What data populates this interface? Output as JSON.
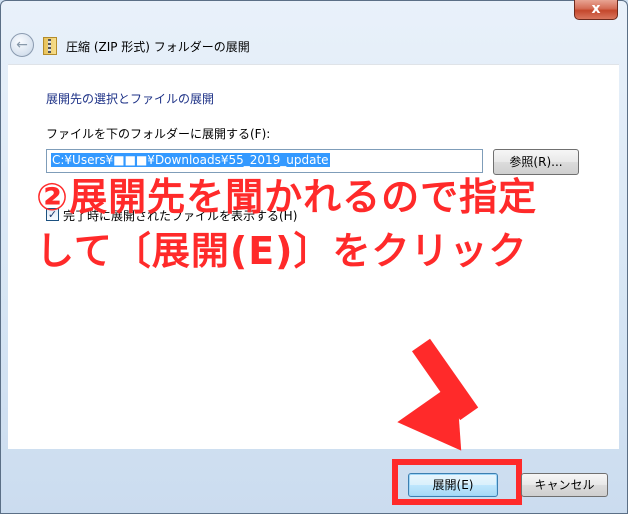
{
  "window": {
    "close_label": "x",
    "title": "圧縮 (ZIP 形式) フォルダーの展開"
  },
  "header": {
    "back_icon": "back-arrow-icon",
    "folder_icon": "zip-folder-icon"
  },
  "main": {
    "section_title": "展開先の選択とファイルの展開",
    "field_label": "ファイルを下のフォルダーに展開する(F):",
    "path_value": "C:¥Users¥■■■¥Downloads¥55_2019_update",
    "browse_label": "参照(R)...",
    "checkbox_checked": true,
    "checkbox_mark": "✓",
    "checkbox_label": "完了時に展開されたファイルを表示する(H)"
  },
  "annotation": {
    "line1": "②展開先を聞かれるので指定",
    "line2": "して〔展開(E)〕をクリック",
    "color": "#ff2a2a"
  },
  "footer": {
    "extract_label": "展開(E)",
    "cancel_label": "キャンセル"
  }
}
